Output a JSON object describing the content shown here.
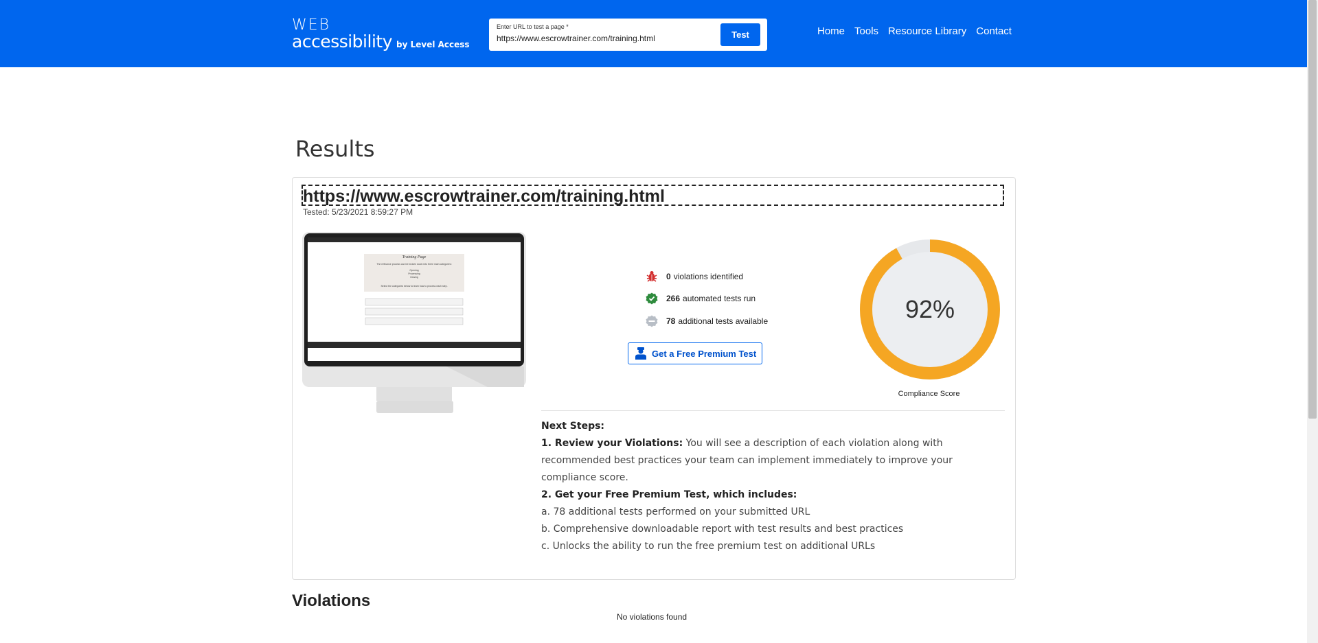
{
  "header": {
    "logo_line1": "WEB",
    "logo_line2": "accessibility",
    "logo_by": "by Level Access",
    "url_label": "Enter URL to test a page *",
    "url_value": "https://www.escrowtrainer.com/training.html",
    "test_button": "Test",
    "nav": [
      "Home",
      "Tools",
      "Resource Library",
      "Contact"
    ],
    "color": "#0066ee"
  },
  "main": {
    "title": "Results",
    "tested_url": "https://www.escrowtrainer.com/training.html",
    "tested_date": "Tested: 5/23/2021 8:59:27 PM",
    "preview": {
      "page_title": "Training Page",
      "intro": "The refinance process can be broken down into three main categories:",
      "categories": [
        "Opening",
        "Processing",
        "Closing"
      ],
      "instruction": "Select the categories below to learn how to process each step."
    },
    "stats": [
      {
        "value": "0",
        "label": "violations identified",
        "icon": "bug-icon"
      },
      {
        "value": "266",
        "label": "automated tests run",
        "icon": "check-badge-icon"
      },
      {
        "value": "78",
        "label": "additional tests available",
        "icon": "minus-badge-icon"
      }
    ],
    "premium_button": "Get a Free Premium Test",
    "score": {
      "value": 92,
      "text": "92%",
      "label": "Compliance Score",
      "color": "#f5a623"
    },
    "next_steps": {
      "heading": "Next Steps:",
      "step1_title": "1. Review your Violations:",
      "step1_text": " You will see a description of each violation along with recommended best practices your team can implement immediately to improve your compliance score.",
      "step2_title": "2. Get your Free Premium Test, which includes:",
      "items": [
        "a. 78 additional tests performed on your submitted URL",
        "b. Comprehensive downloadable report with test results and best practices",
        "c. Unlocks the ability to run the free premium test on additional URLs"
      ]
    }
  },
  "violations": {
    "title": "Violations",
    "empty_text": "No violations found"
  }
}
